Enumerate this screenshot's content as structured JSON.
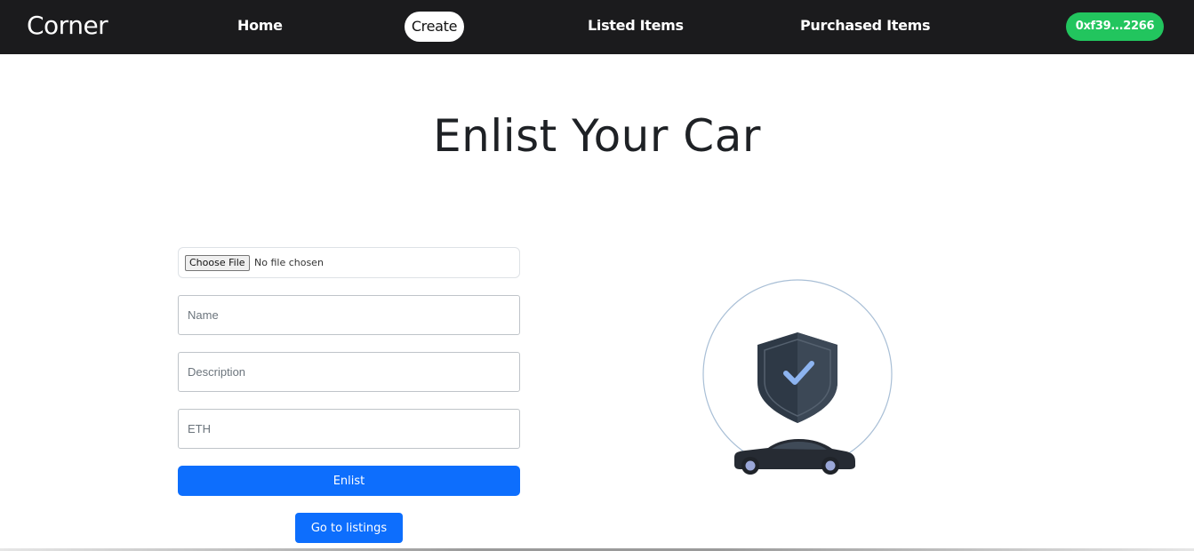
{
  "nav": {
    "brand": "Corner",
    "links": {
      "home": "Home",
      "create": "Create",
      "listed": "Listed Items",
      "purchased": "Purchased Items"
    },
    "wallet": "0xf39...2266"
  },
  "page": {
    "title": "Enlist Your Car"
  },
  "form": {
    "file_button": "Choose File",
    "file_status": "No file chosen",
    "name_placeholder": "Name",
    "description_placeholder": "Description",
    "eth_placeholder": "ETH",
    "enlist_label": "Enlist",
    "listings_label": "Go to listings"
  },
  "illustration": {
    "icons": [
      "shield-check-icon",
      "car-icon"
    ]
  },
  "colors": {
    "navbar": "#1b1b1d",
    "primary": "#0d6efd",
    "wallet": "#22c55e"
  }
}
